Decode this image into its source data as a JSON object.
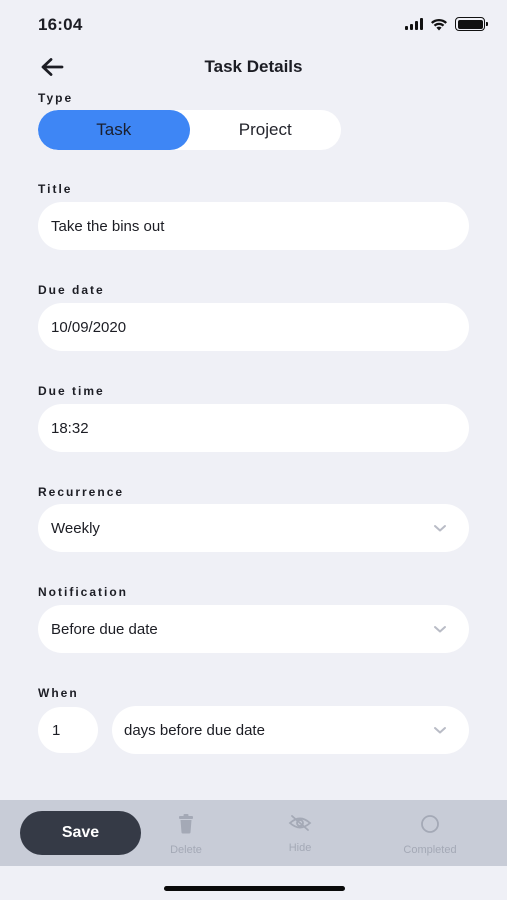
{
  "status_bar": {
    "time": "16:04"
  },
  "header": {
    "title": "Task Details"
  },
  "type": {
    "label": "Type",
    "options": [
      "Task",
      "Project"
    ],
    "selected": "Task"
  },
  "title_field": {
    "label": "Title",
    "value": "Take the bins out"
  },
  "due_date": {
    "label": "Due date",
    "value": "10/09/2020"
  },
  "due_time": {
    "label": "Due time",
    "value": "18:32"
  },
  "recurrence": {
    "label": "Recurrence",
    "value": "Weekly"
  },
  "notification": {
    "label": "Notification",
    "value": "Before due date"
  },
  "when": {
    "label": "When",
    "number": "1",
    "unit": "days before due date"
  },
  "toolbar": {
    "save_label": "Save",
    "delete_label": "Delete",
    "hide_label": "Hide",
    "completed_label": "Completed"
  },
  "colors": {
    "accent": "#3e86f5",
    "background": "#eff0f6",
    "toolbar": "#c8ccd7",
    "save_button": "#353a46"
  },
  "icons": {
    "back": "arrow-left-icon",
    "chevron": "chevron-down-icon",
    "delete": "trash-icon",
    "hide": "eye-off-icon",
    "completed": "circle-icon"
  }
}
